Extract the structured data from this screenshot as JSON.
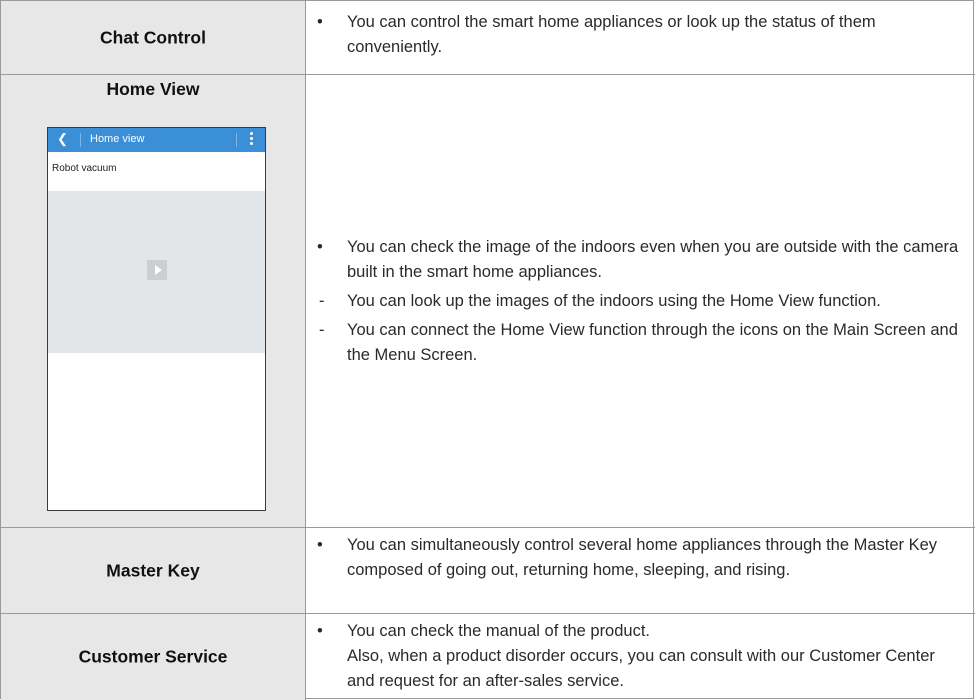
{
  "rows": [
    {
      "title": "Chat Control",
      "items": [
        {
          "marker": "•",
          "text": "You can control the smart home appliances or look up the status of them conveniently."
        }
      ]
    },
    {
      "title": "Home View",
      "phone": {
        "back_icon": "back-arrow-icon",
        "title": "Home view",
        "menu_icon": "more-vertical-icon",
        "device_label": "Robot vacuum",
        "play_icon": "play-icon"
      },
      "items": [
        {
          "marker": "•",
          "text": "You can check the image of the indoors even when you are outside with the camera built in the smart home appliances."
        },
        {
          "marker": "-",
          "text": "You can look up the images of the indoors using the Home View function."
        },
        {
          "marker": "-",
          "text": "You can connect the Home View function through the icons on the Main Screen and the Menu Screen."
        }
      ]
    },
    {
      "title": "Master Key",
      "items": [
        {
          "marker": "•",
          "text": "You can simultaneously control several home appliances through the Master Key composed of going out, returning home, sleeping, and rising."
        }
      ]
    },
    {
      "title": "Customer Service",
      "items": [
        {
          "marker": "•",
          "text": "You can check the manual of the product.",
          "text2": "Also, when a product disorder occurs, you can consult with our Customer Center and request for an after-sales service."
        }
      ]
    }
  ],
  "colors": {
    "header_bg": "#e7e7e7",
    "border": "#9a9a9a",
    "phone_bar": "#3b8fd6"
  }
}
